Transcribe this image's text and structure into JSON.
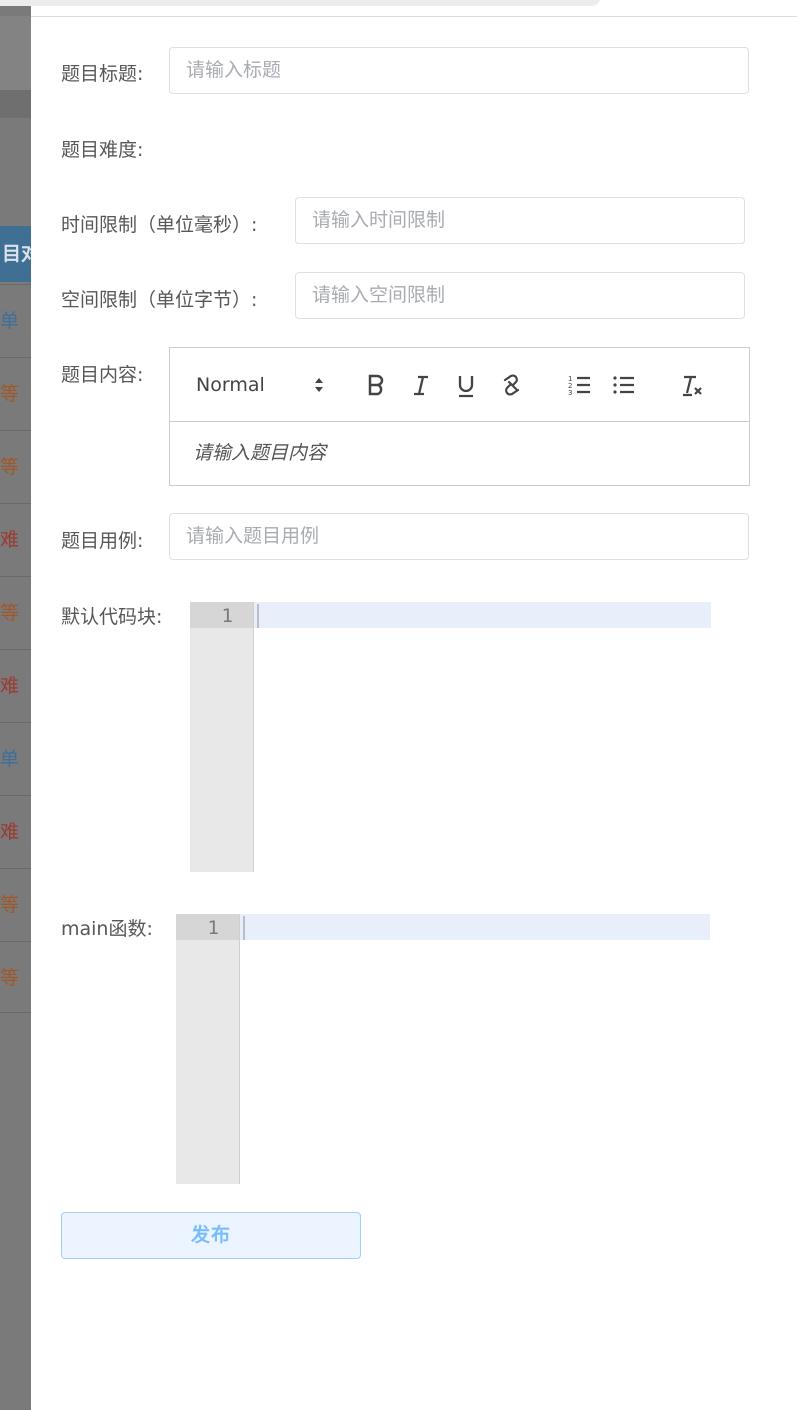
{
  "background": {
    "table_header_fragment": "目对",
    "difficulty_cells": [
      "单",
      "等",
      "等",
      "难",
      "等",
      "难",
      "单",
      "难",
      "等",
      "等"
    ]
  },
  "form": {
    "title_label": "题目标题:",
    "title_placeholder": "请输入标题",
    "difficulty_label": "题目难度:",
    "time_limit_label": "时间限制（单位毫秒）:",
    "time_limit_placeholder": "请输入时间限制",
    "space_limit_label": "空间限制（单位字节）:",
    "space_limit_placeholder": "请输入空间限制",
    "content_label": "题目内容:",
    "content_placeholder": "请输入题目内容",
    "example_label": "题目用例:",
    "example_placeholder": "请输入题目用例",
    "default_code_label": "默认代码块:",
    "main_func_label": "main函数:",
    "publish_label": "发布"
  },
  "editor_toolbar": {
    "header_select": "Normal",
    "buttons": [
      "bold-icon",
      "italic-icon",
      "underline-icon",
      "link-icon",
      "ordered-list-icon",
      "bullet-list-icon",
      "clear-format-icon"
    ]
  },
  "code_editors": {
    "default_code_line_number": "1",
    "main_func_line_number": "1"
  },
  "colors": {
    "primary_plain_bg": "#ecf5ff",
    "primary_plain_text": "#79bbff",
    "active_line": "#e8eefa"
  }
}
